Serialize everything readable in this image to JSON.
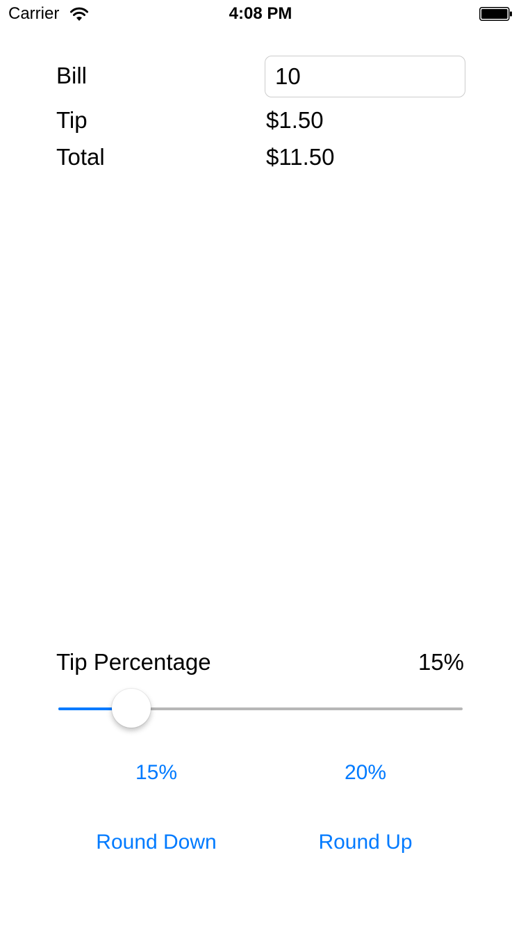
{
  "status_bar": {
    "carrier": "Carrier",
    "time": "4:08 PM",
    "wifi_icon": "wifi-icon",
    "battery_icon": "battery-icon"
  },
  "bill": {
    "label": "Bill",
    "value": "10"
  },
  "tip": {
    "label": "Tip",
    "value": "$1.50"
  },
  "total": {
    "label": "Total",
    "value": "$11.50"
  },
  "tip_percentage": {
    "label": "Tip Percentage",
    "value": "15%",
    "slider_level": 0.18
  },
  "presets": {
    "left": "15%",
    "right": "20%"
  },
  "rounding": {
    "down": "Round Down",
    "up": "Round Up"
  },
  "colors": {
    "accent": "#007aff",
    "track": "#b7b7b7"
  }
}
